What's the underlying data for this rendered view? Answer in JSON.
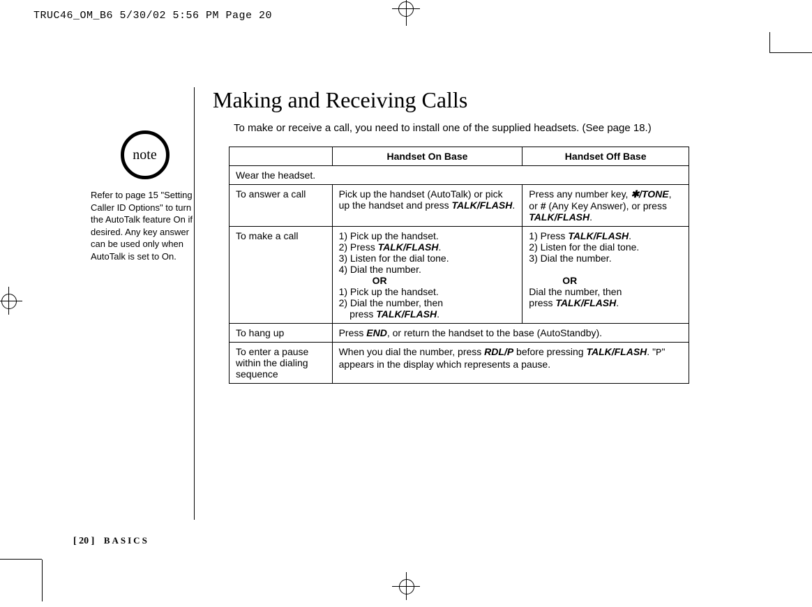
{
  "print_header": "TRUC46_OM_B6  5/30/02  5:56 PM  Page 20",
  "title": "Making and Receiving Calls",
  "intro": "To make or receive a call, you need to install one of the supplied headsets. (See page 18.)",
  "note": {
    "icon_label": "note",
    "text": "Refer to page 15 \"Setting Caller ID Options\" to turn the AutoTalk feature On if desired. Any key answer can be used only when AutoTalk is set to On."
  },
  "table": {
    "header": {
      "col1": "",
      "col2": "Handset On Base",
      "col3": "Handset Off Base"
    },
    "rows": [
      {
        "label": "Wear the headset.",
        "span": true
      },
      {
        "label": "To answer a call",
        "on_base": {
          "pre": "Pick up the handset (AutoTalk) or pick up the handset and press ",
          "key1": "TALK/FLASH",
          "post": "."
        },
        "off_base": {
          "pre": "Press any number key, ",
          "k1": "✱/TONE",
          "mid1": ", or ",
          "k2": "#",
          "mid2": " (Any Key Answer), or press ",
          "k3": "TALK/FLASH",
          "post": "."
        }
      },
      {
        "label": "To make a call",
        "on_base": {
          "l1": "1) Pick up the handset.",
          "l2a": "2) Press ",
          "l2b": "TALK/FLASH",
          "l2c": ".",
          "l3": "3) Listen for the dial tone.",
          "l4": "4) Dial the number.",
          "or": "OR",
          "l5": "1) Pick up the handset.",
          "l6": "2) Dial the number, then",
          "l7a": "    press ",
          "l7b": "TALK/FLASH",
          "l7c": "."
        },
        "off_base": {
          "l1a": "1) Press ",
          "l1b": "TALK/FLASH",
          "l1c": ".",
          "l2": "2) Listen for the dial tone.",
          "l3": "3) Dial the number.",
          "or": "OR",
          "l4": "Dial the number, then",
          "l5a": "press ",
          "l5b": "TALK/FLASH",
          "l5c": "."
        }
      },
      {
        "label": "To hang up",
        "merged": {
          "pre": "Press ",
          "k1": "END",
          "post": ", or return the handset to the base (AutoStandby)."
        }
      },
      {
        "label": "To enter a pause within the dialing sequence",
        "merged": {
          "pre": "When you dial the number, press ",
          "k1": "RDL/P",
          "mid": " before pressing ",
          "k2": "TALK/FLASH",
          "mid2": ". \"",
          "p": "P",
          "post": "\" appears in the display which represents a pause."
        }
      }
    ]
  },
  "footer": {
    "page": "[ 20 ]",
    "section": "BASICS"
  }
}
